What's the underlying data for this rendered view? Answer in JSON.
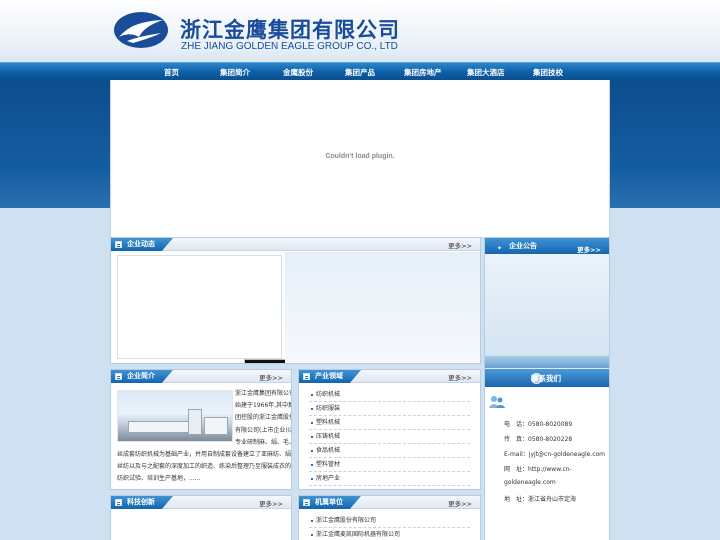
{
  "header": {
    "logo_cn": "浙江金鹰集团有限公司",
    "logo_en": "ZHE JIANG GOLDEN EAGLE GROUP CO., LTD"
  },
  "nav": {
    "items": [
      "首页",
      "集团简介",
      "金鹰股份",
      "集团产品",
      "集团房地产",
      "集团大酒店",
      "集团技校"
    ]
  },
  "banner": {
    "plugin_message": "Couldn't load plugin."
  },
  "news": {
    "title": "企业动态",
    "more": "更多>>"
  },
  "notice": {
    "title": "企业公告",
    "more": "更多>>"
  },
  "intro": {
    "title": "企业简介",
    "more": "更多>>",
    "text": "浙江金鹰集团有限公司始建于1966年,其中集团控股的浙江金鹰股份有限公司(上市企业)以专业研制麻、绢、毛、丝成套纺织机械为基础产业，并用自制成套设备建立了亚麻纺、绢丝纺以及与之配套的深度加工的织造、练染后整理乃至服装成衣的纺织试验、培训生产基地，......"
  },
  "industry": {
    "title": "产业领域",
    "more": "更多>>",
    "items": [
      "纺织机械",
      "纺织服装",
      "塑料机械",
      "压铸机械",
      "食品机械",
      "塑料管材",
      "房地产业"
    ]
  },
  "contact": {
    "title": "联系我们",
    "phone": "电　话：0580-8020089",
    "fax": "传　真：0580-8020228",
    "email": "E-mail：jyjt@cn-goldeneagle.com",
    "site_line1": "网　址：http://www.cn-",
    "site_line2": "goldeneagle.com",
    "address": "地　址：浙江省舟山市定海"
  },
  "tech": {
    "title": "科技创新",
    "more": "更多>>"
  },
  "units": {
    "title": "机属单位",
    "more": "更多>>",
    "items": [
      "浙江金鹰股份有限公司",
      "浙江金鹰麦凯国际机器有限公司"
    ]
  },
  "colors": {
    "brand_blue": "#1a4c99",
    "nav_blue": "#0b5fa8",
    "tab_blue": "#1265ad"
  }
}
